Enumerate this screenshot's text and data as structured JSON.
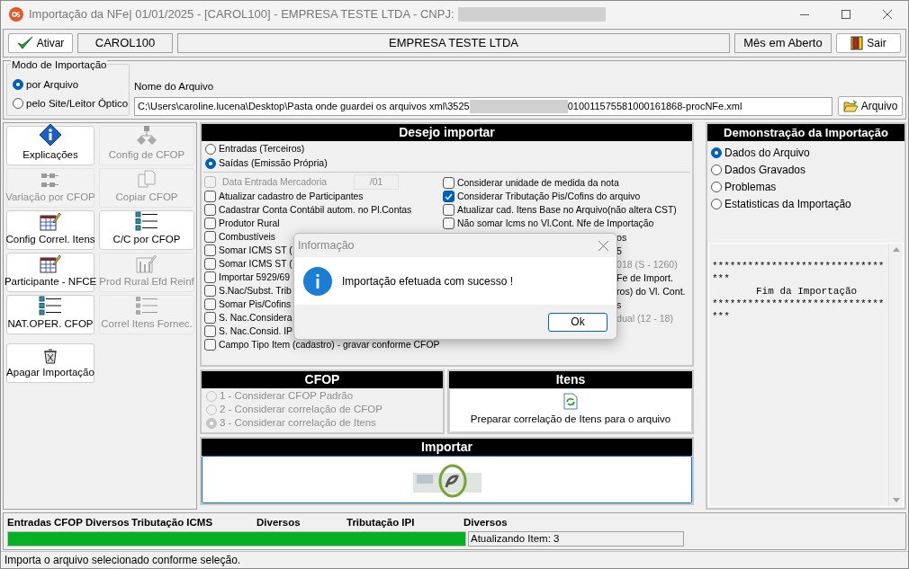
{
  "window": {
    "title": "Importação da NFe|  01/01/2025 - [CAROL100] - EMPRESA TESTE LTDA - CNPJ:"
  },
  "toolbar": {
    "activate_button": "Ativar",
    "user": "CAROL100",
    "company": "EMPRESA TESTE LTDA",
    "period": "Mês em Aberto",
    "exit_button": "Sair"
  },
  "import_mode": {
    "label": "Modo de Importação",
    "options": [
      {
        "label": "por Arquivo",
        "selected": true
      },
      {
        "label": "pelo Site/Leitor Óptico",
        "selected": false
      }
    ]
  },
  "file": {
    "label": "Nome do Arquivo",
    "value_start": "C:\\Users\\caroline.lucena\\Desktop\\Pasta onde guardei os arquivos xml\\3525",
    "value_end": "010011575581000161868-procNFe.xml",
    "button": "Arquivo"
  },
  "shortcuts": [
    {
      "label": "Explicações",
      "disabled": false
    },
    {
      "label": "Config de CFOP",
      "disabled": true
    },
    {
      "label": "Variação por CFOP",
      "disabled": true
    },
    {
      "label": "Copiar CFOP",
      "disabled": true
    },
    {
      "label": "Config Correl. Itens",
      "disabled": false
    },
    {
      "label": "C/C por CFOP",
      "disabled": false
    },
    {
      "label": "Participante - NFCE",
      "disabled": false
    },
    {
      "label": "Prod Rural Efd Reinf",
      "disabled": true
    },
    {
      "label": "NAT.OPER. CFOP",
      "disabled": false
    },
    {
      "label": "Correl Itens Fornec.",
      "disabled": true
    },
    {
      "label": "Apagar Importação",
      "disabled": false
    }
  ],
  "options_panel": {
    "title": "Desejo importar",
    "direction": [
      {
        "label": "Entradas (Terceiros)",
        "selected": false
      },
      {
        "label": "Saídas (Emissão Própria)",
        "selected": true
      }
    ],
    "left": [
      {
        "kind": "date",
        "label": "Data Entrada Mercadoria",
        "value": "/01",
        "checked": false,
        "disabled": true
      },
      {
        "kind": "check",
        "label": "Atualizar cadastro de Participantes",
        "checked": false,
        "disabled": false
      },
      {
        "kind": "check",
        "label": "Cadastrar Conta Contábil autom. no Pl.Contas",
        "checked": false,
        "disabled": false
      },
      {
        "kind": "check",
        "label": "Produtor Rural",
        "checked": false,
        "disabled": false
      },
      {
        "kind": "check",
        "label": "Combustíveis",
        "checked": false,
        "disabled": false
      },
      {
        "kind": "check",
        "label": "Somar ICMS ST (",
        "checked": false,
        "disabled": false
      },
      {
        "kind": "check",
        "label": "Somar ICMS ST (",
        "checked": false,
        "disabled": false
      },
      {
        "kind": "check",
        "label": "Importar 5929/69",
        "checked": false,
        "disabled": false
      },
      {
        "kind": "check",
        "label": "S.Nac/Subst. Trib",
        "checked": false,
        "disabled": false
      },
      {
        "kind": "check",
        "label": "Somar Pis/Cofins",
        "checked": false,
        "disabled": false
      },
      {
        "kind": "check",
        "label": "S. Nac.Considera",
        "checked": false,
        "disabled": false
      },
      {
        "kind": "check",
        "label": "S. Nac.Consid. IP",
        "checked": false,
        "disabled": false
      },
      {
        "kind": "check",
        "label": "Campo Tipo Item (cadastro) - gravar conforme CFOP",
        "checked": false,
        "disabled": false
      }
    ],
    "right": [
      {
        "kind": "check",
        "label": "Considerar unidade de medida da nota",
        "checked": false,
        "disabled": false
      },
      {
        "kind": "check",
        "label": "Considerar Tributação Pis/Cofins do arquivo",
        "checked": true,
        "disabled": false
      },
      {
        "kind": "check",
        "label": "Atualizar cad. Itens Base no Arquivo(não altera CST)",
        "checked": false,
        "disabled": false
      },
      {
        "kind": "check",
        "label": "Não somar Icms no Vl.Cont. Nfe de Importação",
        "checked": false,
        "disabled": false
      },
      {
        "kind": "covered",
        "label": "os",
        "disabled": false
      },
      {
        "kind": "covered",
        "label": "5",
        "disabled": false
      },
      {
        "kind": "covered",
        "label": "018 (S - 1260)",
        "disabled": true
      },
      {
        "kind": "covered",
        "label": "Fe de Import.",
        "disabled": false
      },
      {
        "kind": "covered",
        "label": "ros) do Vl. Cont.",
        "disabled": false
      },
      {
        "kind": "covered",
        "label": "s",
        "disabled": false
      },
      {
        "kind": "covered",
        "label": "dual (12 - 18)",
        "disabled": true
      }
    ]
  },
  "cfop": {
    "title": "CFOP",
    "disabled": true,
    "options": [
      {
        "label": "1 - Considerar CFOP Padrão",
        "selected": false
      },
      {
        "label": "2 - Considerar correlação de CFOP",
        "selected": false
      },
      {
        "label": "3 - Considerar correlação de Itens",
        "selected": true
      }
    ]
  },
  "items": {
    "title": "Itens",
    "button": "Preparar correlação de Itens para o arquivo"
  },
  "import": {
    "title": "Importar"
  },
  "demo": {
    "title": "Demonstração da Importação",
    "options": [
      {
        "label": "Dados do Arquivo",
        "selected": true
      },
      {
        "label": "Dados Gravados",
        "selected": false
      },
      {
        "label": "Problemas",
        "selected": false
      },
      {
        "label": "Estatisticas da Importação",
        "selected": false
      }
    ],
    "log": [
      "*****************************",
      "***",
      "Fim da Importação",
      "*****************************",
      "***"
    ]
  },
  "progress": {
    "columns": [
      "Entradas",
      "CFOP",
      "Diversos",
      "Tributação ICMS",
      "Diversos",
      "Tributação IPI",
      "Diversos"
    ],
    "level": 1,
    "message": "Atualizando Item: 3"
  },
  "status_bar": "Importa o arquivo selecionado conforme seleção.",
  "dialog": {
    "title": "Informação",
    "message": "Importação efetuada com sucesso !",
    "button": "Ok"
  }
}
